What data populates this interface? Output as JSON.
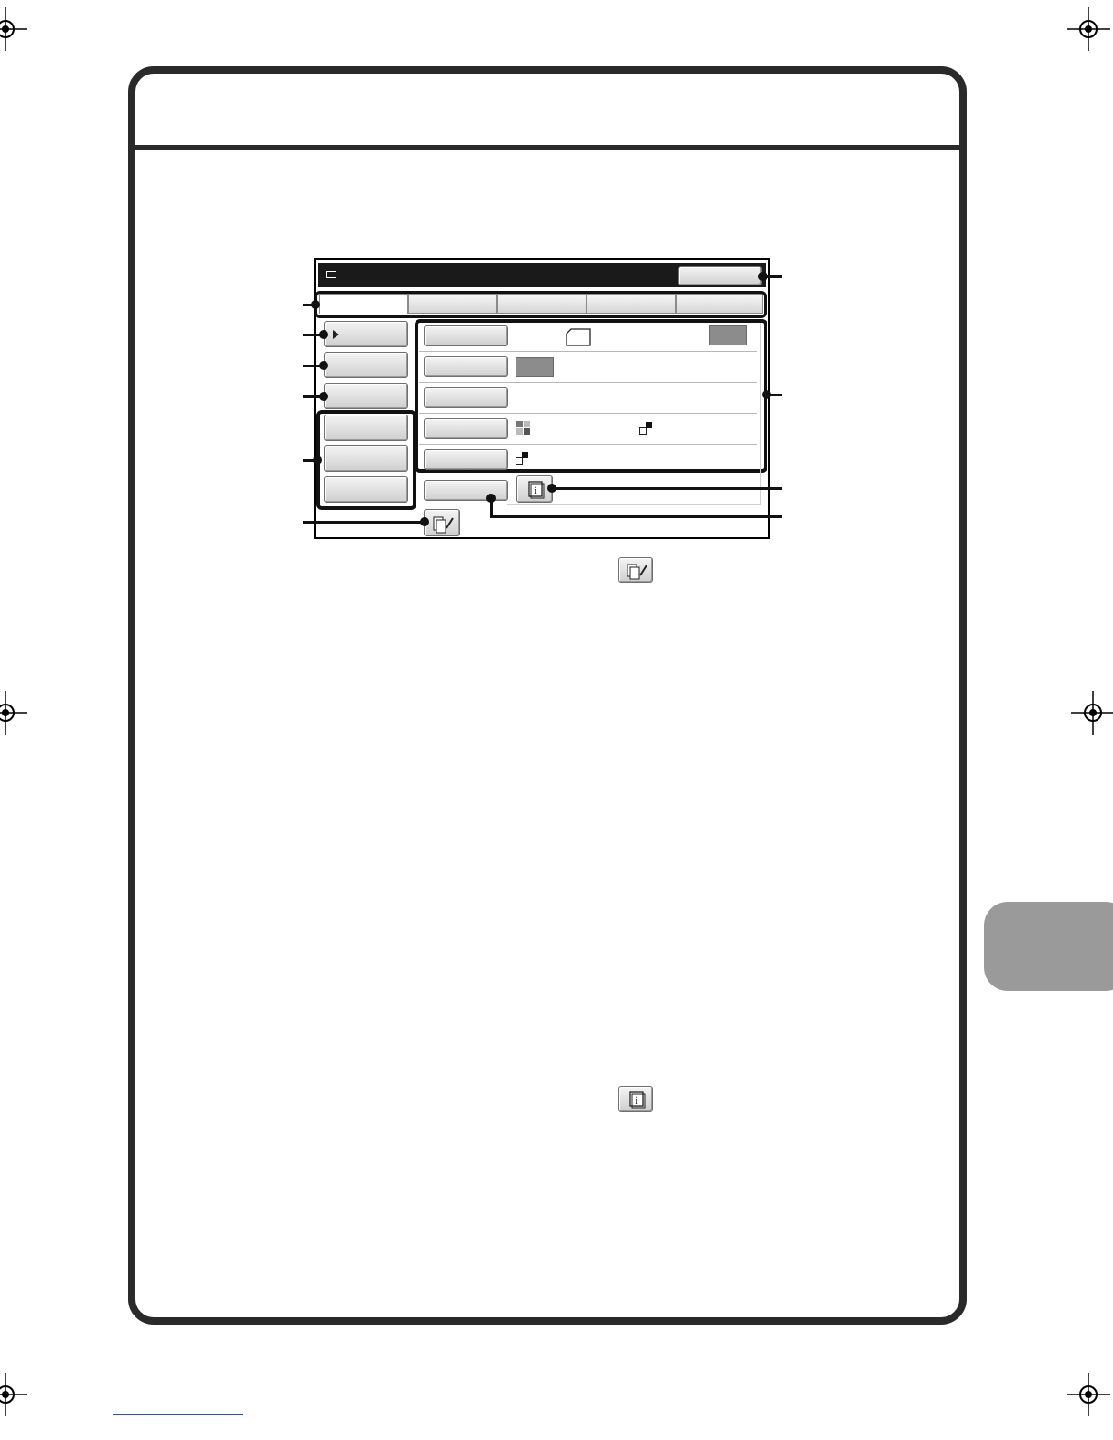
{
  "page": {
    "header_title": "",
    "colors": {
      "frame": "#2a2a2a",
      "thumb_tab": "#9a9a9a",
      "title_bar": "#1a1a1a",
      "highlight": "#111111",
      "bottom_link": "#3a4fb8"
    }
  },
  "screen": {
    "title": "",
    "top_right_button": "",
    "tabs": [
      "",
      "",
      "",
      "",
      ""
    ],
    "left_menu": [
      "",
      "",
      "",
      "",
      "",
      ""
    ],
    "settings_rows": [
      {
        "button": "",
        "value": ""
      },
      {
        "button": "",
        "value": ""
      },
      {
        "button": "",
        "value": ""
      },
      {
        "button": "",
        "value": ""
      },
      {
        "button": "",
        "value": ""
      }
    ],
    "extra_button": "",
    "icons": {
      "title": "mail-icon",
      "edit": "address-edit-icon",
      "info": "info-icon",
      "original_size": "paper-icon",
      "color_mode": "color-mode-icon",
      "mono_mode": "mono-mode-icon"
    }
  }
}
